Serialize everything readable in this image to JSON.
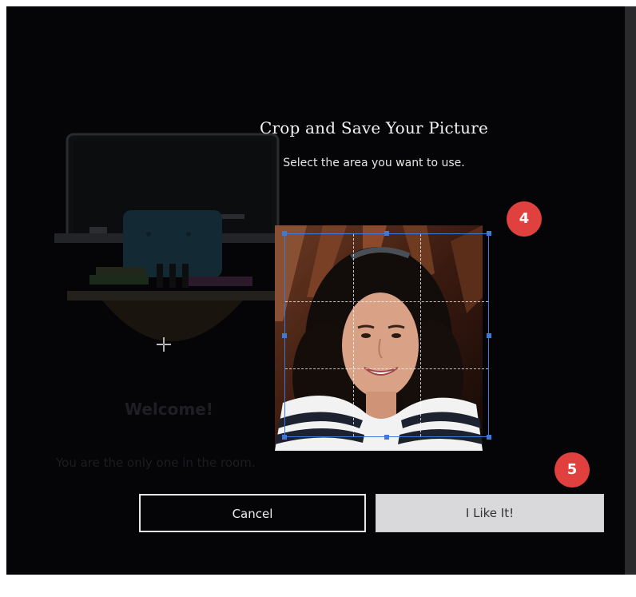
{
  "dialog": {
    "title": "Crop and Save Your Picture",
    "subtitle": "Select the area you want to use."
  },
  "background": {
    "welcome": "Welcome!",
    "message": "You are the only one in the room."
  },
  "badges": {
    "step4": "4",
    "step5": "5"
  },
  "buttons": {
    "cancel": "Cancel",
    "confirm": "I Like It!"
  },
  "colors": {
    "screen_bg": "#050507",
    "badge": "#e0413e",
    "crop_frame": "#3d79d6",
    "confirm_bg": "#d9d9dc"
  },
  "icons": {
    "cursor": "crosshair-cursor-icon",
    "photo": "profile-photo"
  }
}
